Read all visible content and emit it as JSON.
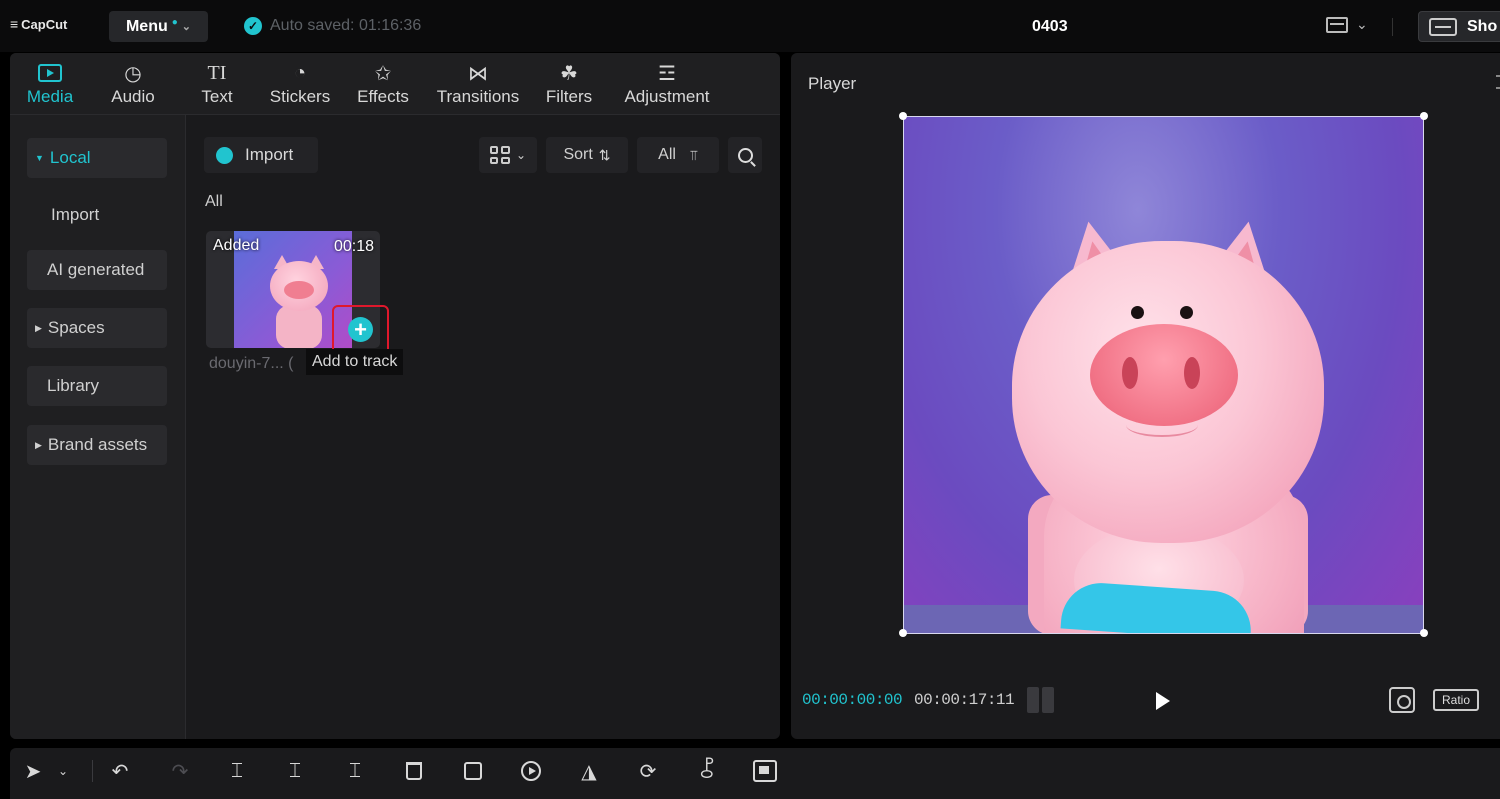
{
  "app": {
    "logo_text": "CapCut",
    "menu_label": "Menu",
    "autosave_text": "Auto saved: 01:16:36",
    "project_title": "0403",
    "shortcuts_label": "Sho"
  },
  "media_tabs": [
    {
      "label": "Media",
      "icon": "media-icon",
      "active": true
    },
    {
      "label": "Audio",
      "icon": "audio-icon"
    },
    {
      "label": "Text",
      "icon": "text-icon"
    },
    {
      "label": "Stickers",
      "icon": "stickers-icon"
    },
    {
      "label": "Effects",
      "icon": "effects-icon"
    },
    {
      "label": "Transitions",
      "icon": "transitions-icon"
    },
    {
      "label": "Filters",
      "icon": "filters-icon"
    },
    {
      "label": "Adjustment",
      "icon": "adjustment-icon"
    }
  ],
  "side_nav": [
    {
      "label": "Local",
      "active": true,
      "expandable": true
    },
    {
      "label": "Import"
    },
    {
      "label": "AI generated"
    },
    {
      "label": "Spaces",
      "expandable": true
    },
    {
      "label": "Library"
    },
    {
      "label": "Brand assets",
      "expandable": true
    }
  ],
  "media_toolbar": {
    "import_label": "Import",
    "sort_label": "Sort",
    "filter_label": "All"
  },
  "media_section_title": "All",
  "media_item": {
    "badge": "Added",
    "duration": "00:18",
    "name": "douyin-7... (",
    "add_tooltip": "Add to track"
  },
  "player": {
    "title": "Player",
    "current_time": "00:00:00:00",
    "total_time": "00:00:17:11",
    "ratio_label": "Ratio"
  },
  "colors": {
    "accent": "#21c4cf",
    "highlight": "#e0182c",
    "panel": "#1a1a1c",
    "background": "#000000"
  }
}
